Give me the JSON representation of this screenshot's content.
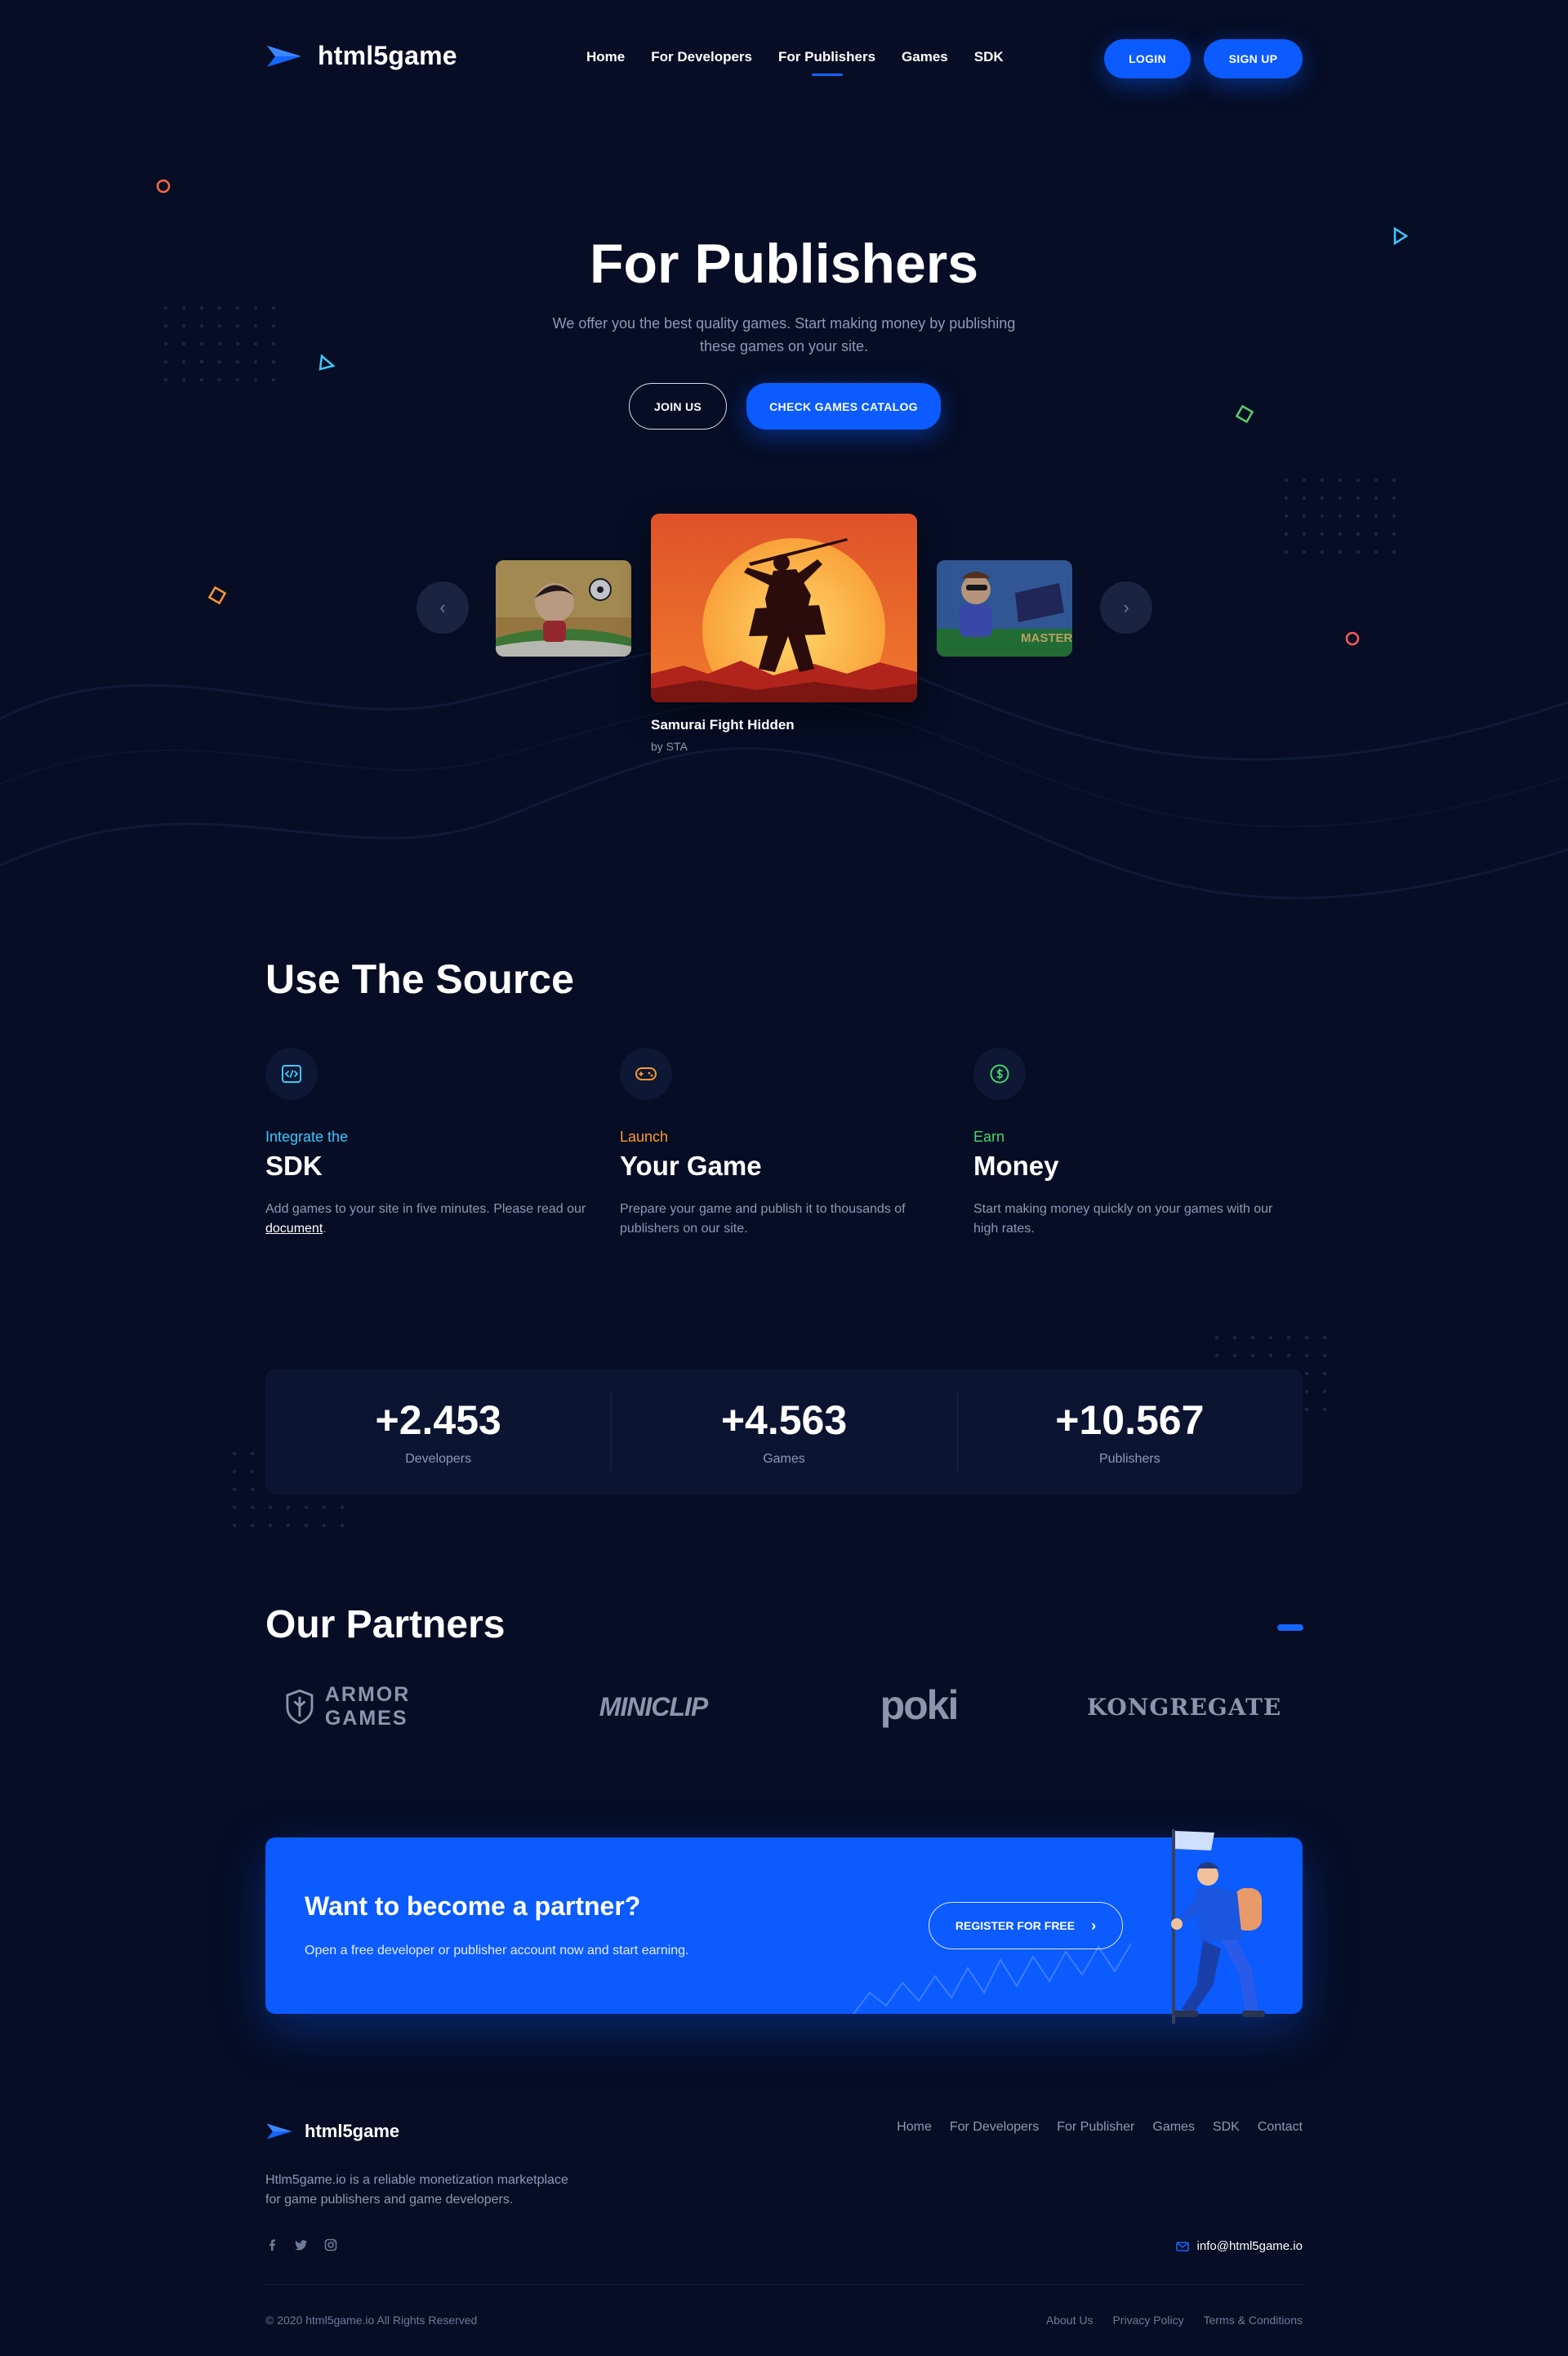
{
  "header": {
    "brand": "html5game",
    "nav": [
      {
        "label": "Home",
        "active": false
      },
      {
        "label": "For Developers",
        "active": false
      },
      {
        "label": "For Publishers",
        "active": true
      },
      {
        "label": "Games",
        "active": false
      },
      {
        "label": "SDK",
        "active": false
      }
    ],
    "login_label": "LOGIN",
    "signup_label": "SIGN UP"
  },
  "hero": {
    "title": "For Publishers",
    "subtitle_line1": "We offer you the best quality games. Start making money by publishing",
    "subtitle_line2": "these games on your site.",
    "join_label": "JOIN US",
    "catalog_label": "CHECK GAMES CATALOG"
  },
  "carousel": {
    "featured_title": "Samurai Fight Hidden",
    "featured_author": "by STA",
    "right_thumb_text": "MASTERS"
  },
  "source": {
    "title": "Use The Source",
    "features": [
      {
        "kicker": "Integrate the",
        "title": "SDK",
        "desc_pre": "Add games to your site in five minutes. Please read our ",
        "desc_link": "document",
        "desc_post": ".",
        "color": "#3cc8ff",
        "icon": "code-icon"
      },
      {
        "kicker": "Launch",
        "title": "Your Game",
        "desc": "Prepare your game and publish it to thousands of publishers on our site.",
        "color": "#ff9a2e",
        "icon": "gamepad-icon"
      },
      {
        "kicker": "Earn",
        "title": "Money",
        "desc": "Start making money quickly on your games with our high rates.",
        "color": "#45d66b",
        "icon": "dollar-icon"
      }
    ]
  },
  "stats": [
    {
      "value": "+2.453",
      "label": "Developers"
    },
    {
      "value": "+4.563",
      "label": "Games"
    },
    {
      "value": "+10.567",
      "label": "Publishers"
    }
  ],
  "partners": {
    "title": "Our Partners",
    "logos": [
      "ARMOR GAMES",
      "MINICLIP",
      "poki",
      "KONGREGATE"
    ]
  },
  "cta": {
    "title": "Want to become a partner?",
    "subtitle": "Open a free developer or publisher account now and start earning.",
    "button_label": "REGISTER FOR FREE"
  },
  "footer": {
    "brand": "html5game",
    "nav": [
      "Home",
      "For Developers",
      "For Publisher",
      "Games",
      "SDK",
      "Contact"
    ],
    "desc_line1": "Htlm5game.io is a reliable monetization marketplace",
    "desc_line2": "for game publishers and game developers.",
    "email": "info@html5game.io",
    "copyright": "© 2020 html5game.io All Rights Reserved",
    "legal": [
      "About Us",
      "Privacy Policy",
      "Terms & Conditions"
    ]
  },
  "colors": {
    "background": "#060d24",
    "accent": "#0b5bff",
    "card": "#0b1431",
    "muted": "#8e98b8"
  }
}
